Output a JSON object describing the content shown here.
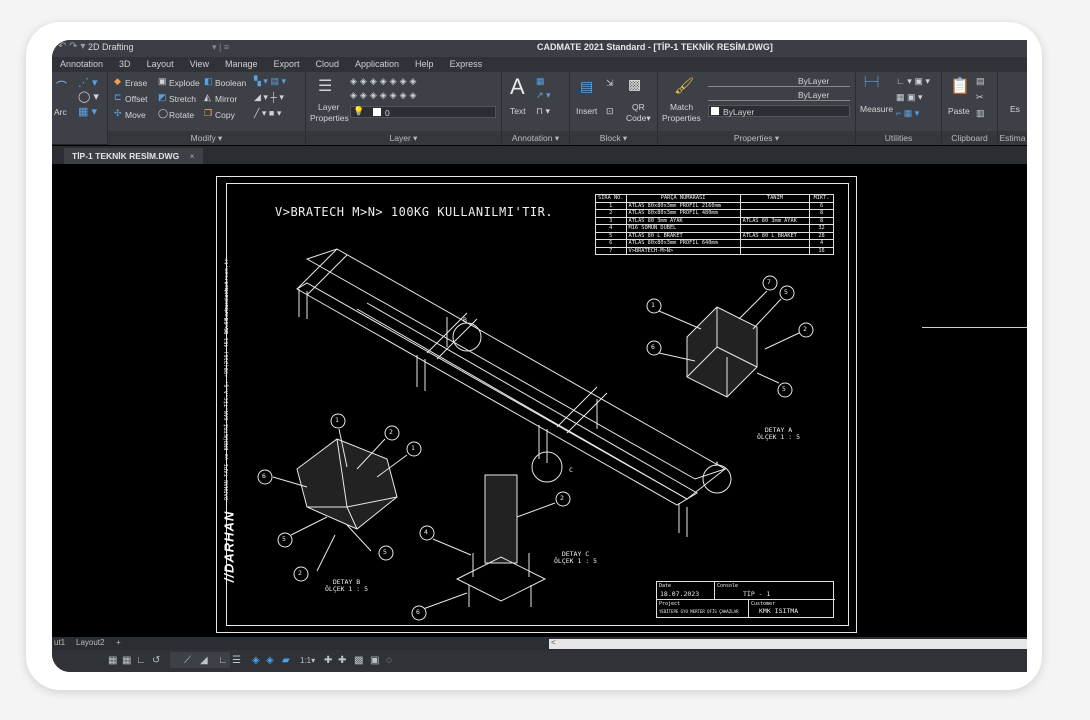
{
  "quick_access": {
    "arrows": "↶ ↷ ▾",
    "workspace": "2D Drafting",
    "separator": "▾ | ≡"
  },
  "app_title": "CADMATE 2021 Standard - [TİP-1 TEKNİK RESİM.DWG]",
  "menu": [
    "Annotation",
    "3D",
    "Layout",
    "View",
    "Manage",
    "Export",
    "Cloud",
    "Application",
    "Help",
    "Express"
  ],
  "ribbon": {
    "draw": {
      "arc_label": "Arc"
    },
    "modify": {
      "label": "Modify ▾",
      "tools": [
        "Erase",
        "Explode",
        "Boolean",
        "Offset",
        "Stretch",
        "Mirror",
        "Move",
        "Rotate",
        "Copy"
      ]
    },
    "layer": {
      "label": "Layer ▾",
      "props_line1": "Layer",
      "props_line2": "Properties",
      "current": "0"
    },
    "annotation": {
      "label": "Annotation ▾",
      "text": "Text",
      "glyph": "A"
    },
    "block": {
      "label": "Block ▾",
      "insert": "Insert",
      "qr_line1": "QR",
      "qr_line2": "Code▾"
    },
    "properties": {
      "label": "Properties ▾",
      "match_line1": "Match",
      "match_line2": "Properties",
      "bylayer": "ByLayer"
    },
    "utilities": {
      "label": "Utilities",
      "measure": "Measure"
    },
    "clipboard": {
      "label": "Clipboard",
      "paste": "Paste"
    },
    "estimate": {
      "label": "Estima",
      "short": "Es"
    }
  },
  "document_tab": {
    "title": "TİP-1 TEKNİK RESİM.DWG",
    "close": "×"
  },
  "drawing": {
    "title": "V>BRATECH M>N> 100KG KULLANILMI'TIR.",
    "side_text": "DARHAN TAPI ve ENDÜSTRİ SAN.TİC.A.Ş.   +90(216) 451 06 86   www.darhan.com.tr",
    "side_web": "www.darhan.com.tr",
    "logo": "//DARHAN",
    "parts_table": {
      "headers": [
        "SIRA NO.",
        "PARÇA NUMARASI",
        "TANIM",
        "MİKT."
      ],
      "rows": [
        [
          "1",
          "ATLAS 80x80x3mm PROFİL 2160mm",
          "",
          "6"
        ],
        [
          "2",
          "ATLAS 80x80x3mm PROFİL 480mm",
          "",
          "8"
        ],
        [
          "3",
          "ATLAS 80 3mm AYAK",
          "ATLAS 80 3mm AYAK",
          "8"
        ],
        [
          "4",
          "M16 SOMUN DÜBEL",
          "",
          "32"
        ],
        [
          "5",
          "ATLAS 80 L BRAKET",
          "ATLAS 80 L BRAKET",
          "28"
        ],
        [
          "6",
          "ATLAS 80x80x3mm PROFİL 640mm",
          "",
          "4"
        ],
        [
          "7",
          "V>BRATECH-M>N>",
          "",
          "16"
        ]
      ]
    },
    "title_block": {
      "date_label": "Date",
      "date_value": "18.07.2023",
      "console_label": "Console",
      "console_value": "TİP - 1",
      "project_label": "Project",
      "project_value": "YEDİTEPE GYO MERTER OFİS ÇAHAZLAR",
      "customer_label": "Customer",
      "customer_value": "KMK ISITMA"
    },
    "detail_a": {
      "line1": "DETAY A",
      "line2": "ÖLÇEK 1 : 5"
    },
    "detail_b": {
      "line1": "DETAY B",
      "line2": "ÖLÇEK 1 : 5"
    },
    "detail_c": {
      "line1": "DETAY C",
      "line2": "ÖLÇEK 1 : 5"
    },
    "balloon_numbers": [
      "1",
      "2",
      "4",
      "5",
      "6",
      "7"
    ],
    "view_letters": [
      "A",
      "B",
      "C"
    ]
  },
  "layout_tabs": [
    "ut1",
    "Layout2",
    "+"
  ],
  "scroll_arrow": "<",
  "status": {
    "scale": "1:1▾"
  }
}
